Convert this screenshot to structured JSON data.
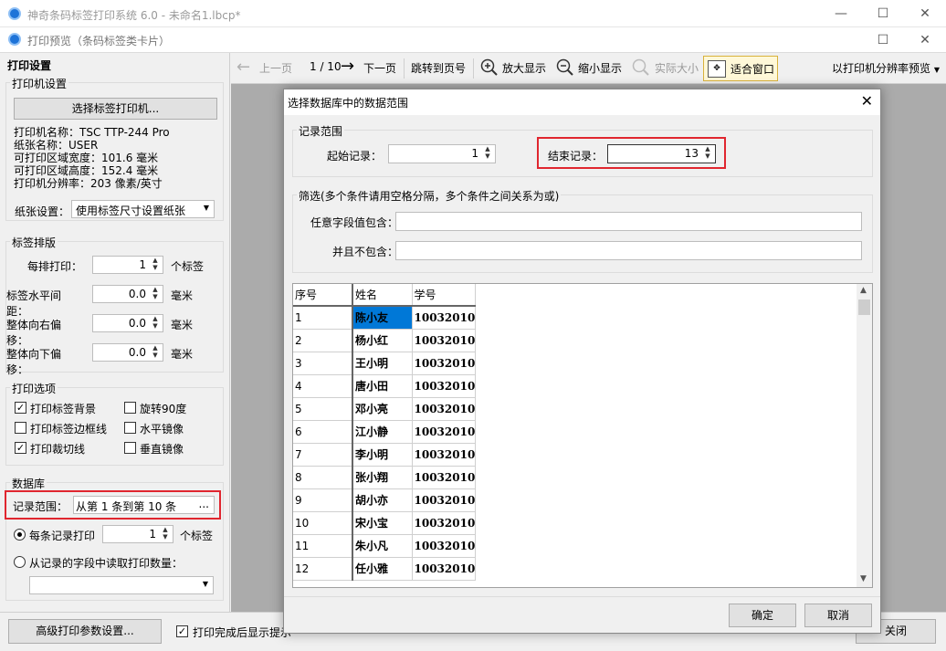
{
  "window": {
    "title": "神奇条码标签打印系统 6.0 - 未命名1.lbcp*",
    "subtitle": "打印预览（条码标签类卡片）"
  },
  "left_panel": {
    "title": "打印设置",
    "printer_group": {
      "label": "打印机设置",
      "select_button": "选择标签打印机...",
      "info_lines": [
        "打印机名称：TSC TTP-244 Pro",
        "纸张名称：USER",
        "可打印区域宽度：101.6 毫米",
        "可打印区域高度：152.4 毫米",
        "打印机分辨率：203 像素/英寸"
      ],
      "paper_label": "纸张设置：",
      "paper_value": "使用标签尺寸设置纸张"
    },
    "layout_group": {
      "label": "标签排版",
      "rows": [
        {
          "label": "每排打印：",
          "value": "1",
          "unit": "个标签"
        },
        {
          "label": "标签水平间距：",
          "value": "0.0",
          "unit": "毫米"
        },
        {
          "label": "整体向右偏移：",
          "value": "0.0",
          "unit": "毫米"
        },
        {
          "label": "整体向下偏移：",
          "value": "0.0",
          "unit": "毫米"
        }
      ]
    },
    "options_group": {
      "label": "打印选项",
      "opt1": "打印标签背景",
      "opt2": "打印标签边框线",
      "opt3": "打印裁切线",
      "opt4": "旋转90度",
      "opt5": "水平镜像",
      "opt6": "垂直镜像"
    },
    "db_group": {
      "label": "数据库",
      "range_label": "记录范围：",
      "range_value": "从第 1 条到第 10 条",
      "range_button": "...",
      "radio1": "每条记录打印",
      "radio1_value": "1",
      "radio1_unit": "个标签",
      "radio2": "从记录的字段中读取打印数量："
    }
  },
  "toolbar": {
    "prev": "上一页",
    "page": "1 / 10",
    "next": "下一页",
    "jump": "跳转到页号",
    "zoom_in": "放大显示",
    "zoom_out": "缩小显示",
    "actual": "实际大小",
    "fit": "适合窗口",
    "preview_mode": "以打印机分辨率预览"
  },
  "bottom": {
    "advanced": "高级打印参数设置...",
    "show_tip": "打印完成后显示提示",
    "close": "关闭"
  },
  "dialog": {
    "title": "选择数据库中的数据范围",
    "range_group": "记录范围",
    "start_label": "起始记录：",
    "start_value": "1",
    "end_label": "结束记录：",
    "end_value": "13",
    "filter_group": "筛选(多个条件请用空格分隔，多个条件之间关系为或)",
    "contains_label": "任意字段值包含：",
    "excludes_label": "并且不包含：",
    "headers": [
      "序号",
      "姓名",
      "学号"
    ],
    "rows": [
      [
        "1",
        "陈小友",
        "10032010"
      ],
      [
        "2",
        "杨小红",
        "10032010"
      ],
      [
        "3",
        "王小明",
        "10032010"
      ],
      [
        "4",
        "唐小田",
        "10032010"
      ],
      [
        "5",
        "邓小亮",
        "10032010"
      ],
      [
        "6",
        "江小静",
        "10032010"
      ],
      [
        "7",
        "李小明",
        "10032010"
      ],
      [
        "8",
        "张小翔",
        "10032010"
      ],
      [
        "9",
        "胡小亦",
        "10032010"
      ],
      [
        "10",
        "宋小宝",
        "10032010"
      ],
      [
        "11",
        "朱小凡",
        "10032010"
      ],
      [
        "12",
        "任小雅",
        "10032010"
      ]
    ],
    "ok": "确定",
    "cancel": "取消"
  }
}
